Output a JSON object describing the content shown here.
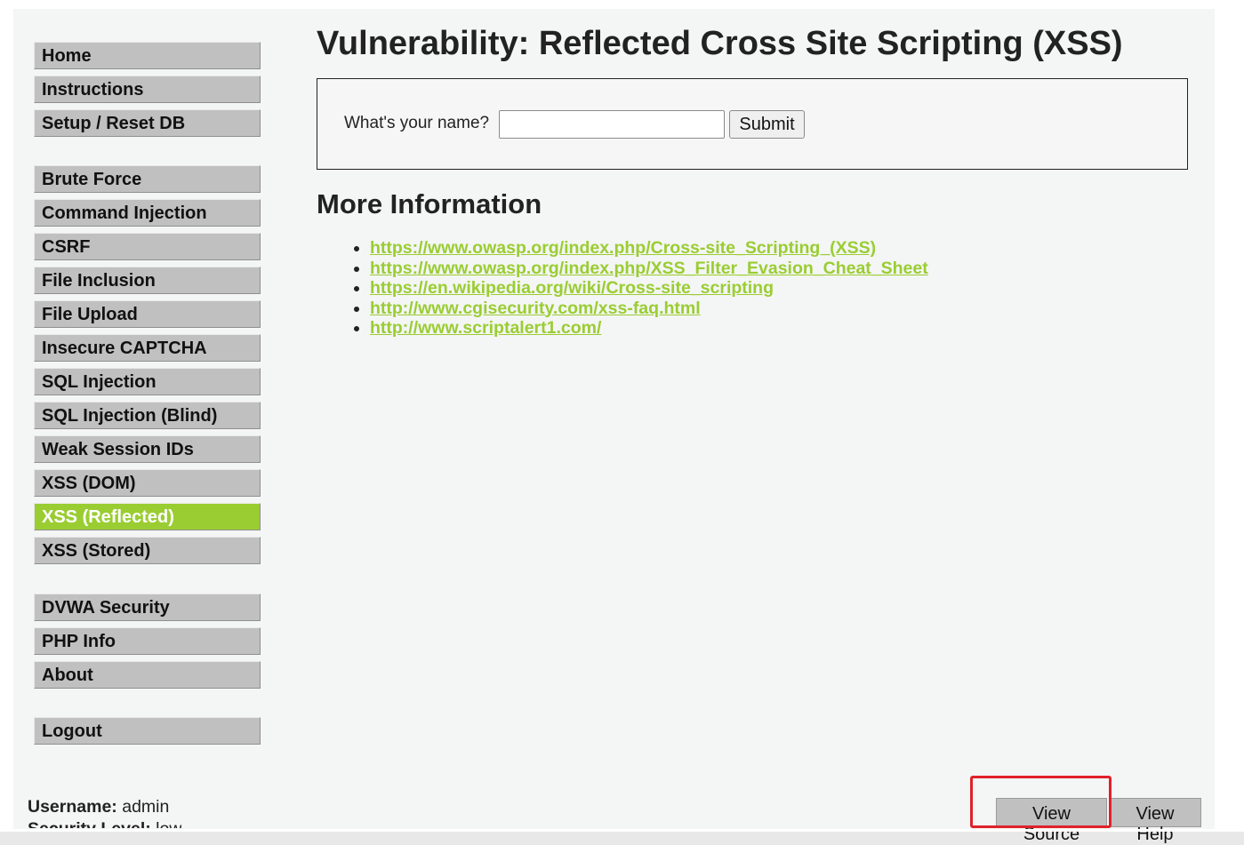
{
  "menu": {
    "group1": [
      {
        "label": "Home"
      },
      {
        "label": "Instructions"
      },
      {
        "label": "Setup / Reset DB"
      }
    ],
    "group2": [
      {
        "label": "Brute Force"
      },
      {
        "label": "Command Injection"
      },
      {
        "label": "CSRF"
      },
      {
        "label": "File Inclusion"
      },
      {
        "label": "File Upload"
      },
      {
        "label": "Insecure CAPTCHA"
      },
      {
        "label": "SQL Injection"
      },
      {
        "label": "SQL Injection (Blind)"
      },
      {
        "label": "Weak Session IDs"
      },
      {
        "label": "XSS (DOM)"
      },
      {
        "label": "XSS (Reflected)",
        "selected": true
      },
      {
        "label": "XSS (Stored)"
      }
    ],
    "group3": [
      {
        "label": "DVWA Security"
      },
      {
        "label": "PHP Info"
      },
      {
        "label": "About"
      }
    ],
    "group4": [
      {
        "label": "Logout"
      }
    ]
  },
  "main": {
    "title": "Vulnerability: Reflected Cross Site Scripting (XSS)",
    "form": {
      "label": "What's your name?",
      "input_value": "",
      "submit_label": "Submit"
    },
    "more_info_heading": "More Information",
    "links": [
      "https://www.owasp.org/index.php/Cross-site_Scripting_(XSS)",
      "https://www.owasp.org/index.php/XSS_Filter_Evasion_Cheat_Sheet",
      "https://en.wikipedia.org/wiki/Cross-site_scripting",
      "http://www.cgisecurity.com/xss-faq.html",
      "http://www.scriptalert1.com/"
    ]
  },
  "footer": {
    "username_label": "Username:",
    "username_value": "admin",
    "security_label": "Security Level:",
    "security_value": "low",
    "view_source_label": "View Source",
    "view_help_label": "View Help"
  },
  "colors": {
    "accent": "#9acd32",
    "menu_bg": "#c0c0c0",
    "highlight": "#e0212a"
  }
}
